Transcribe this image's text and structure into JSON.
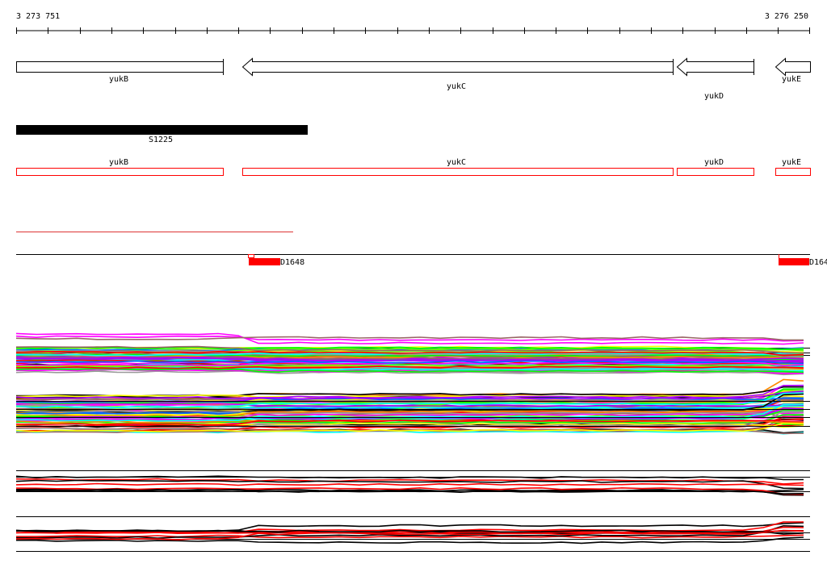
{
  "ruler": {
    "start": "3 273 751",
    "end": "3 276 250"
  },
  "genes": [
    {
      "name": "yukB",
      "strand": "+"
    },
    {
      "name": "yukC",
      "strand": "-"
    },
    {
      "name": "yukD",
      "strand": "-"
    },
    {
      "name": "yukE",
      "strand": "-"
    }
  ],
  "feature": {
    "label": "S1225"
  },
  "annotation_genes": [
    "yukB",
    "yukC",
    "yukD",
    "yukE"
  ],
  "probes": [
    {
      "label": "D1648"
    },
    {
      "label": "D164"
    }
  ],
  "colors": {
    "accent": "#ff0000",
    "palette": [
      "#ff00ff",
      "#ff0000",
      "#00ff00",
      "#0066ff",
      "#ff8800",
      "#00ffff",
      "#ffff00",
      "#999999",
      "#996666",
      "#000000",
      "#aa00ff",
      "#66ff00"
    ]
  }
}
